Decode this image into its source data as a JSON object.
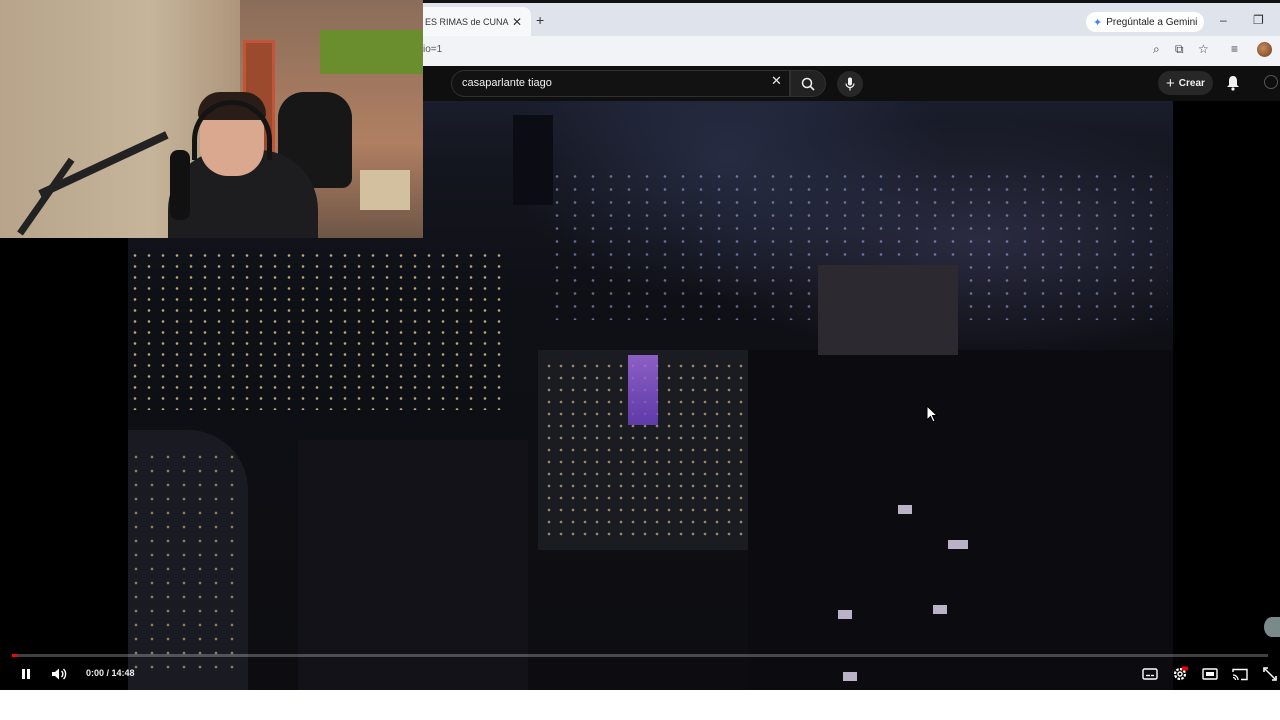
{
  "browser": {
    "tab_title": "ES RIMAS de CUNA D",
    "url_fragment": "io=1",
    "gemini_label": "Pregúntale a Gemini"
  },
  "youtube": {
    "search_value": "casaparlante tiago",
    "create_label": "Crear"
  },
  "player": {
    "time_display": "0:00 / 14:48",
    "progress_fraction": 0.0,
    "state": "playing"
  },
  "icons": {
    "close": "close-icon",
    "search": "search-icon",
    "mic": "mic-icon",
    "bell": "bell-icon",
    "pause": "pause-icon",
    "volume": "volume-icon",
    "subtitles": "subtitles-icon",
    "settings": "settings-icon",
    "theater": "theater-icon",
    "cast": "cast-icon",
    "fullscreen": "fullscreen-icon"
  },
  "colors": {
    "yt_header": "#0f0f0f",
    "progress_red": "#ff0000",
    "browser_chrome": "#dfe3eb"
  }
}
